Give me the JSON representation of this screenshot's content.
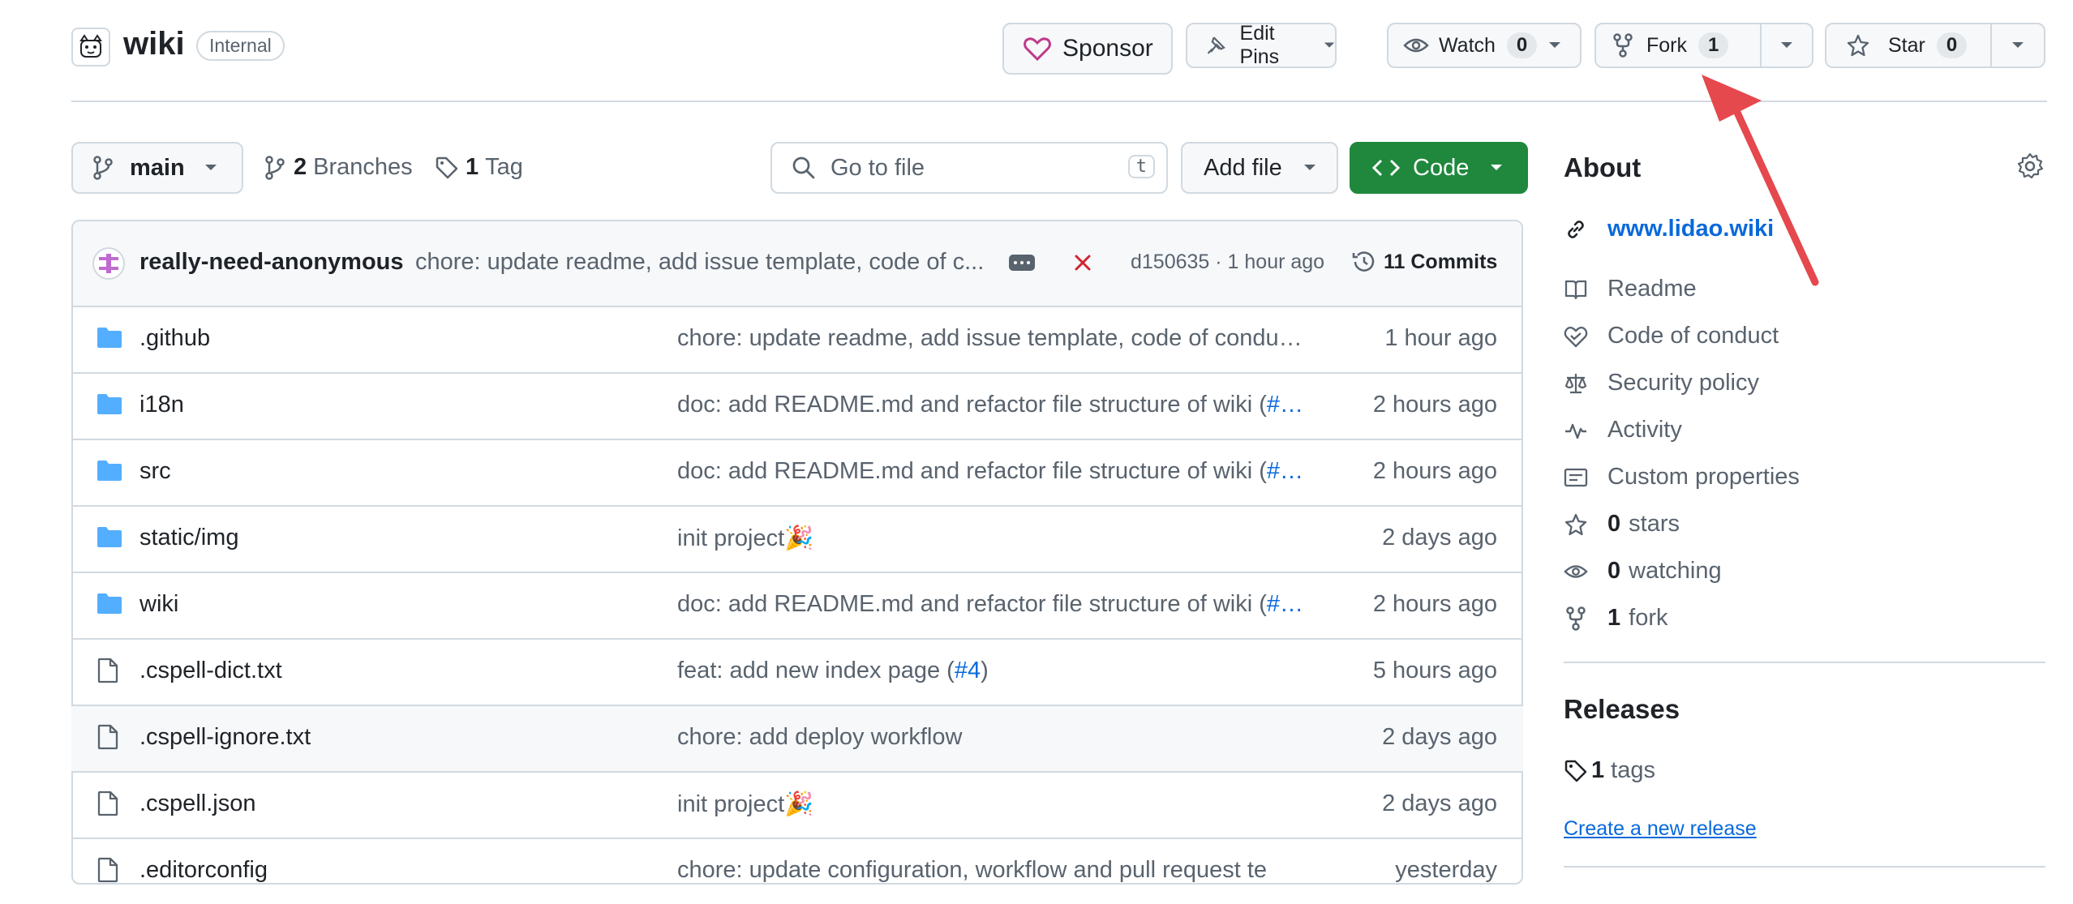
{
  "repo": {
    "name": "wiki",
    "visibility": "Internal"
  },
  "header": {
    "sponsor_label": "Sponsor",
    "edit_pins_label": "Edit Pins",
    "watch_label": "Watch",
    "watch_count": "0",
    "fork_label": "Fork",
    "fork_count": "1",
    "star_label": "Star",
    "star_count": "0"
  },
  "toolbar": {
    "branch": "main",
    "branches_count": "2",
    "branches_label": "Branches",
    "tags_count": "1",
    "tags_label": "Tag",
    "search_placeholder": "Go to file",
    "search_shortcut": "t",
    "add_file_label": "Add file",
    "code_label": "Code"
  },
  "commit": {
    "author": "really-need-anonymous",
    "message": "chore: update readme, add issue template, code of c...",
    "sha_time": "d150635 · 1 hour ago",
    "commits_label": "11 Commits"
  },
  "files": [
    {
      "name": ".github",
      "type": "folder",
      "msg": "chore: update readme, add issue template, code of condu…",
      "link": "",
      "tail": "",
      "time": "1 hour ago"
    },
    {
      "name": "i18n",
      "type": "folder",
      "msg": "doc: add README.md and refactor file structure of wiki (",
      "link": "#…",
      "tail": "",
      "time": "2 hours ago"
    },
    {
      "name": "src",
      "type": "folder",
      "msg": "doc: add README.md and refactor file structure of wiki (",
      "link": "#…",
      "tail": "",
      "time": "2 hours ago"
    },
    {
      "name": "static/img",
      "type": "folder",
      "msg": "init project🎉",
      "link": "",
      "tail": "",
      "time": "2 days ago"
    },
    {
      "name": "wiki",
      "type": "folder",
      "msg": "doc: add README.md and refactor file structure of wiki (",
      "link": "#…",
      "tail": "",
      "time": "2 hours ago"
    },
    {
      "name": ".cspell-dict.txt",
      "type": "file",
      "msg": "feat: add new index page (",
      "link": "#4",
      "tail": ")",
      "time": "5 hours ago"
    },
    {
      "name": ".cspell-ignore.txt",
      "type": "file",
      "msg": "chore: add deploy workflow",
      "link": "",
      "tail": "",
      "time": "2 days ago"
    },
    {
      "name": ".cspell.json",
      "type": "file",
      "msg": "init project🎉",
      "link": "",
      "tail": "",
      "time": "2 days ago"
    },
    {
      "name": ".editorconfig",
      "type": "file",
      "msg": "chore: update configuration, workflow and pull request te",
      "link": "",
      "tail": "",
      "time": "yesterday"
    }
  ],
  "about": {
    "title": "About",
    "website": "www.lidao.wiki",
    "readme": "Readme",
    "code_of_conduct": "Code of conduct",
    "security_policy": "Security policy",
    "activity": "Activity",
    "custom_properties": "Custom properties",
    "stars_count": "0",
    "stars_label": "stars",
    "watching_count": "0",
    "watching_label": "watching",
    "forks_count": "1",
    "forks_label": "fork"
  },
  "releases": {
    "title": "Releases",
    "tags_count": "1",
    "tags_label": "tags",
    "create_label": "Create a new release"
  },
  "colors": {
    "accent": "#0969da",
    "primary_button": "#1f883d",
    "annotation_arrow": "#e5484d"
  }
}
